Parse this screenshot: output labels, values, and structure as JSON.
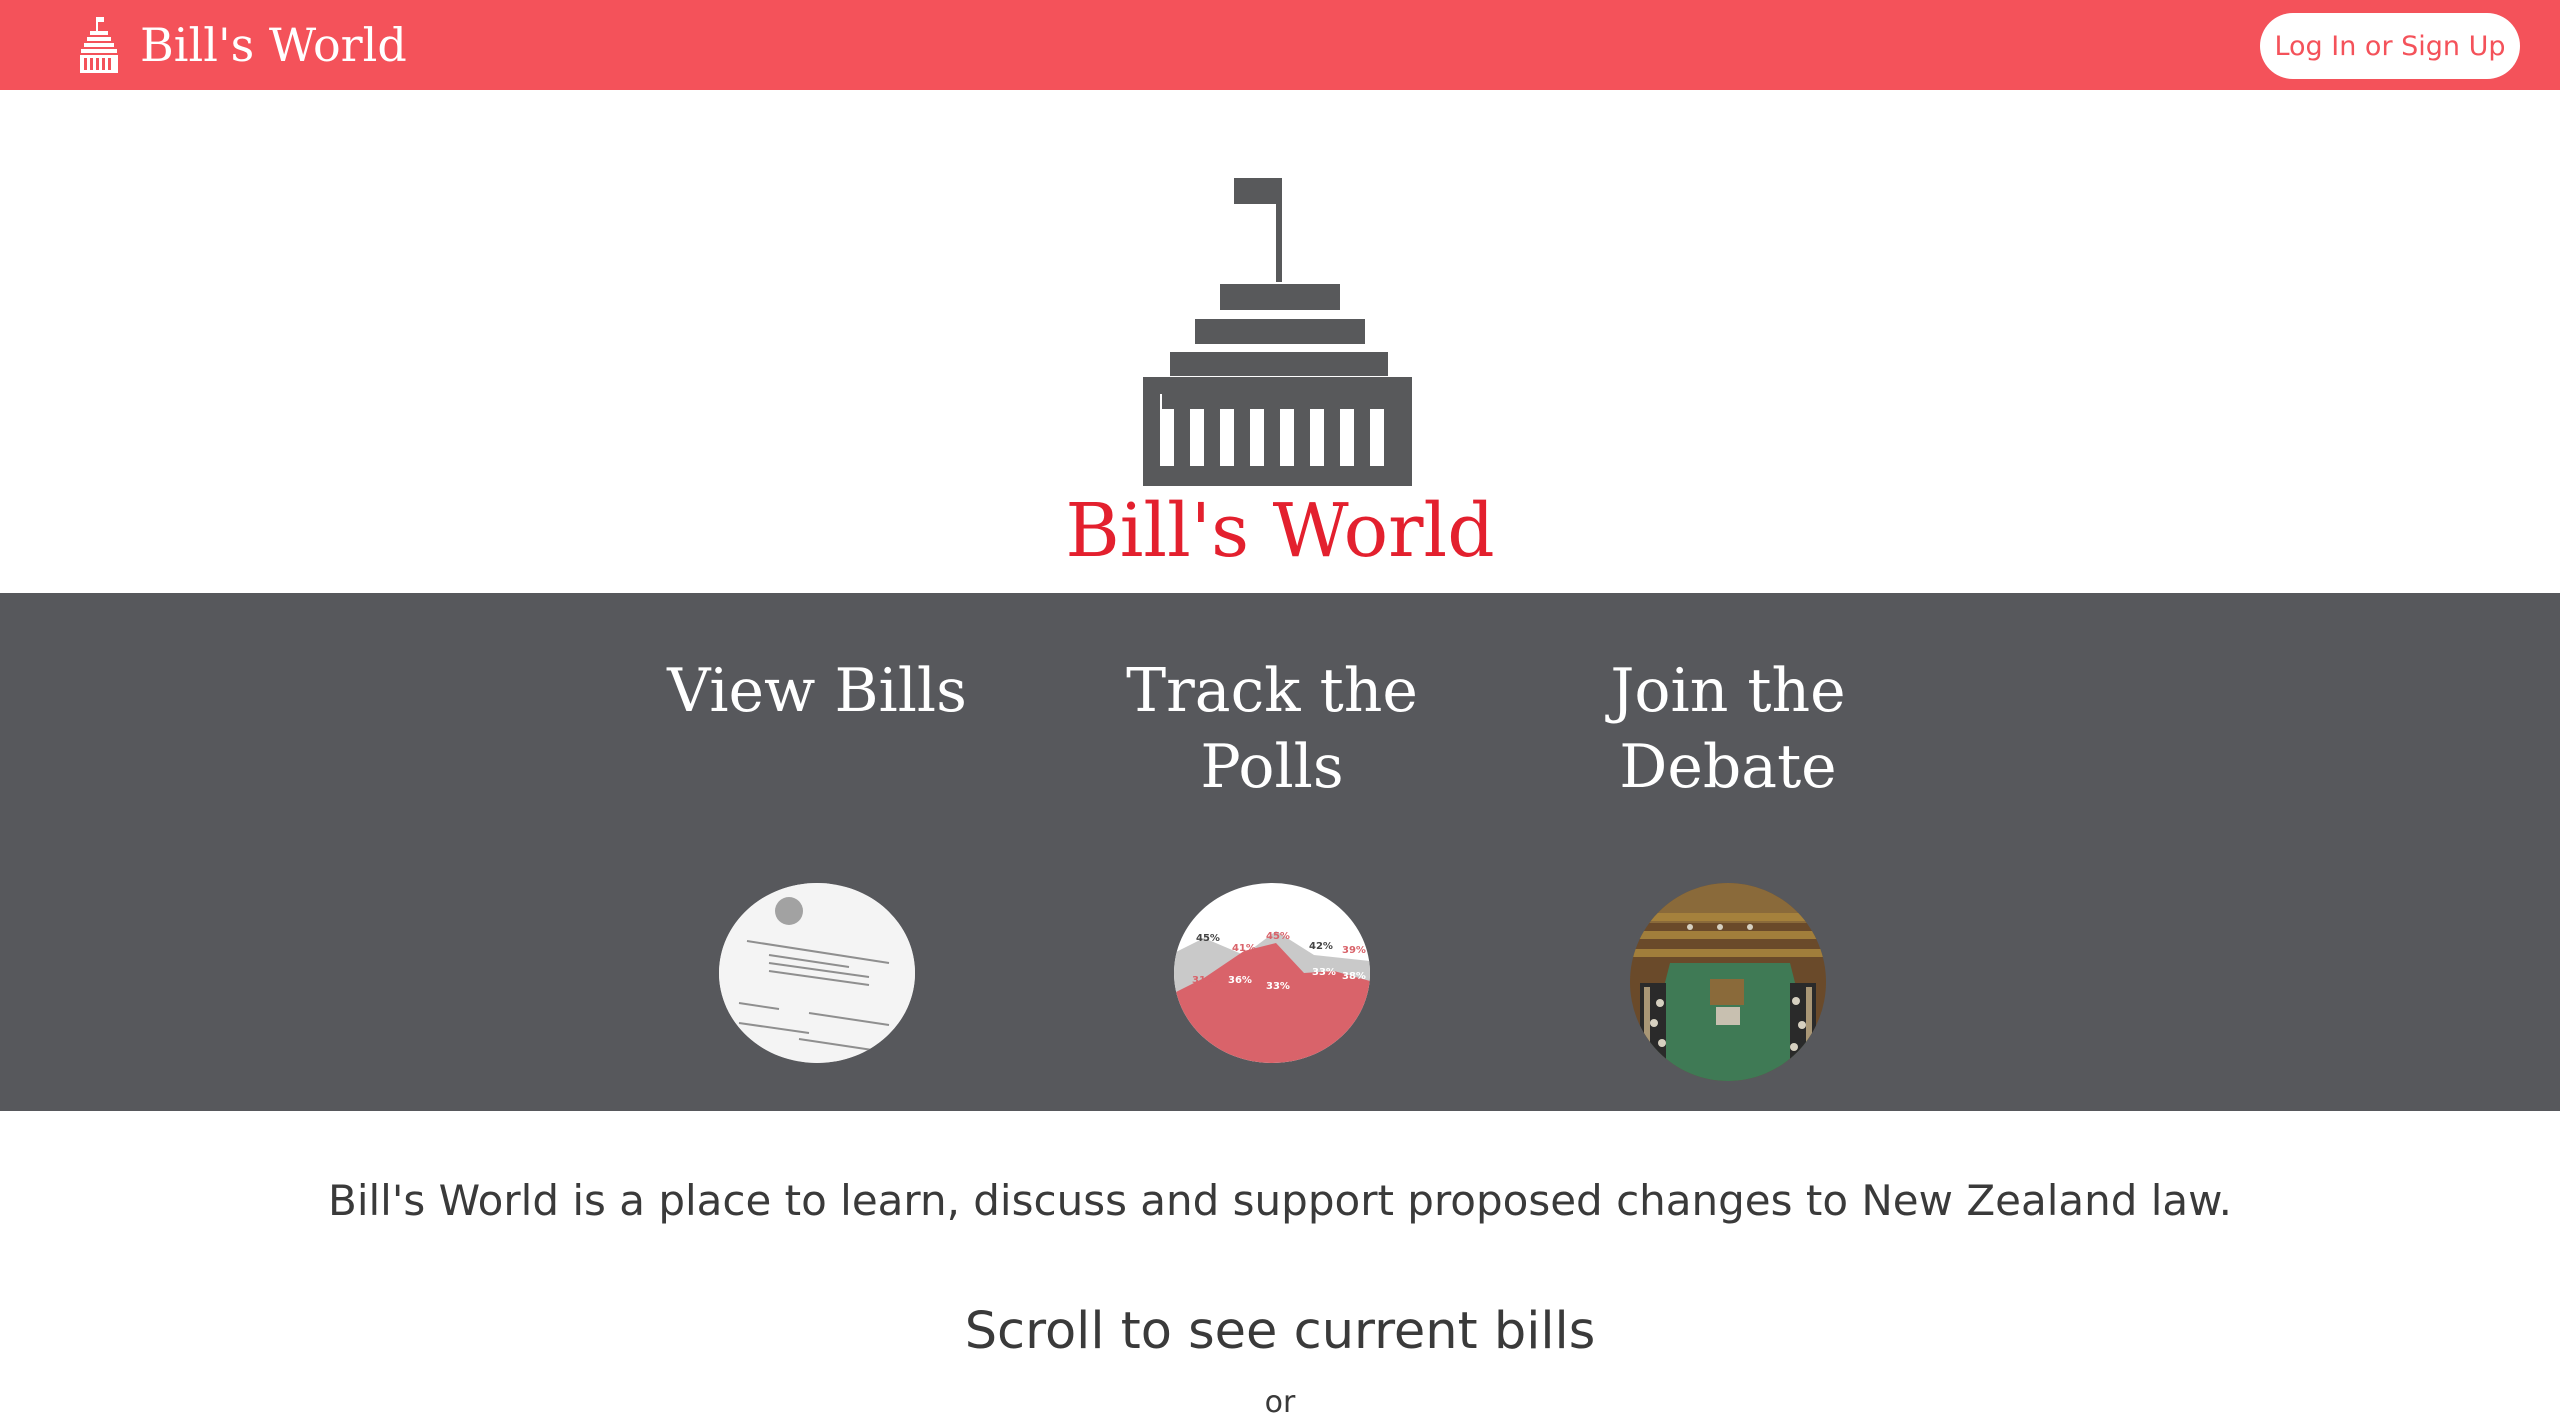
{
  "navbar": {
    "brand_text": "Bill's World",
    "brand_icon": "capitol-dome-icon",
    "login_label": "Log In or Sign Up",
    "bg_color": "#f4525a"
  },
  "hero": {
    "logo_icon": "capitol-dome-icon",
    "title": "Bill's World",
    "title_color": "#e3202e",
    "logo_color": "#58595b"
  },
  "features": {
    "bg_color": "#57585c",
    "items": [
      {
        "title": "View Bills",
        "image": "document-photo"
      },
      {
        "title": "Track the\nPolls",
        "image": "poll-chart-thumbnail"
      },
      {
        "title": "Join the\nDebate",
        "image": "parliament-chamber-photo"
      }
    ],
    "poll_labels": [
      "45%",
      "41%",
      "45%",
      "42%",
      "39%",
      "31%",
      "36%",
      "33%",
      "33%",
      "38%"
    ]
  },
  "tagline": "Bill's World is a place to learn, discuss and support proposed changes to New Zealand law.",
  "scroll_text": "Scroll to see current bills",
  "or_text": "or"
}
